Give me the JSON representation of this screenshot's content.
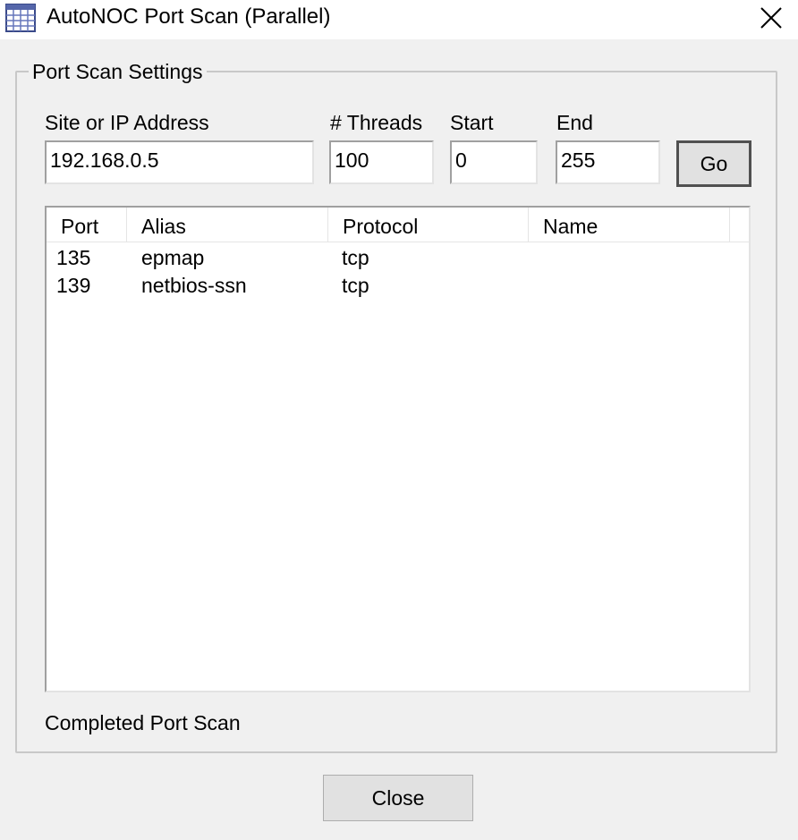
{
  "window": {
    "title": "AutoNOC Port Scan (Parallel)",
    "icon": "grid-app-icon",
    "close_icon": "close-icon"
  },
  "settings": {
    "group_label": "Port Scan Settings",
    "site_label": "Site or IP Address",
    "site_value": "192.168.0.5",
    "threads_label": "# Threads",
    "threads_value": "100",
    "start_label": "Start",
    "start_value": "0",
    "end_label": "End",
    "end_value": "255",
    "go_label": "Go"
  },
  "results": {
    "columns": [
      "Port",
      "Alias",
      "Protocol",
      "Name"
    ],
    "rows": [
      {
        "port": "135",
        "alias": "epmap",
        "protocol": "tcp",
        "name": ""
      },
      {
        "port": "139",
        "alias": "netbios-ssn",
        "protocol": "tcp",
        "name": ""
      }
    ]
  },
  "status": "Completed Port Scan",
  "footer": {
    "close_label": "Close"
  }
}
